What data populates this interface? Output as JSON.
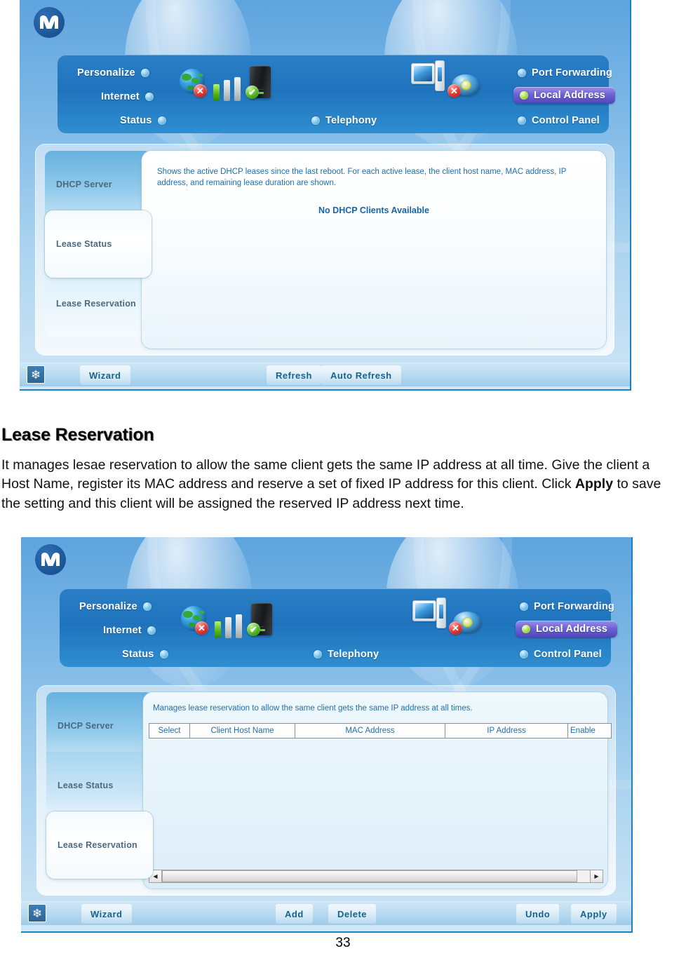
{
  "document": {
    "heading": "Lease Reservation",
    "paragraph_part1": "It manages lesae reservation to allow the same client gets the same IP address at all time. Give the client a Host Name, register its MAC address and reserve a set of fixed IP address for this client. Click ",
    "paragraph_bold": "Apply",
    "paragraph_part2": " to save the setting and this client will be assigned the reserved IP address next time.",
    "page_number": "33"
  },
  "router_ui": {
    "brand_logo": "motorola-batwing-logo",
    "nav_left": [
      {
        "label": "Personalize",
        "led": "blue",
        "active": false
      },
      {
        "label": "Internet",
        "led": "blue",
        "active": false
      },
      {
        "label": "Status",
        "led": "blue",
        "active": false
      }
    ],
    "nav_center": [
      {
        "label": "Telephony",
        "led": "blue",
        "active": false
      }
    ],
    "nav_right": [
      {
        "label": "Port Forwarding",
        "led": "blue",
        "active": false
      },
      {
        "label": "Local Address",
        "led": "green",
        "active": true
      },
      {
        "label": "Control Panel",
        "led": "blue",
        "active": false
      }
    ],
    "status_icons": {
      "internet_globe": "globe-icon",
      "internet_status": "red-x-badge",
      "signal_bars": [
        "on",
        "off",
        "off"
      ],
      "gateway": "server-icon",
      "gateway_status": "green-check-badge",
      "computer": "computer-icon",
      "telephone": "telephone-icon",
      "telephone_status": "red-x-badge"
    },
    "tabs": [
      "DHCP Server",
      "Lease Status",
      "Lease Reservation"
    ]
  },
  "screenshot_one": {
    "active_tab": "Lease Status",
    "description": "Shows the active DHCP leases since the last reboot. For each active lease, the client host name, MAC address, IP address, and remaining lease duration are shown.",
    "empty_message": "No DHCP Clients Available",
    "footer_buttons": [
      "Wizard",
      "Refresh",
      "Auto Refresh"
    ]
  },
  "screenshot_two": {
    "active_tab": "Lease Reservation",
    "description": "Manages lease reservation to allow the same client gets the same IP address at all times.",
    "table": {
      "columns": [
        "Select",
        "Client Host Name",
        "MAC Address",
        "IP Address",
        "Enable"
      ],
      "rows": []
    },
    "scrollbar": {
      "left_arrow": "◀",
      "right_arrow": "▶"
    },
    "footer_buttons": [
      "Wizard",
      "Add",
      "Delete",
      "Undo",
      "Apply"
    ]
  },
  "colors": {
    "accent_blue": "#1884c8",
    "nav_bar": "#2a7fc6",
    "active_nav": "#6f63d4",
    "text_blue": "#1d6fb0",
    "tab_text": "#4b6a82"
  }
}
